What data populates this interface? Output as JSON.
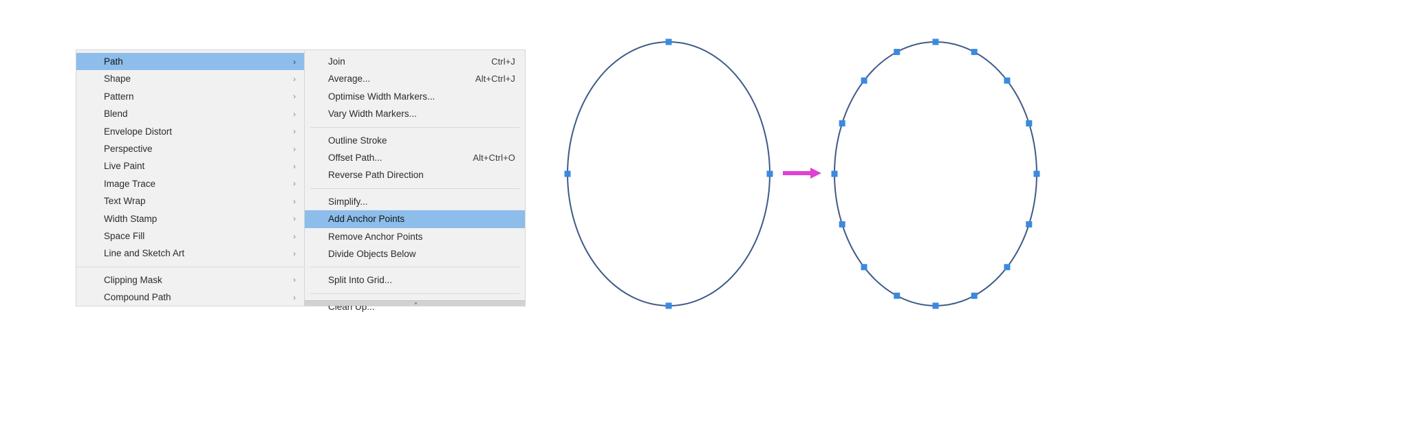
{
  "app": {
    "context": "Adobe Illustrator Object menu cascade showing Path submenu with Add Anchor Points highlighted"
  },
  "menu_level_1": {
    "name": "Object submenu",
    "items": [
      {
        "label": "Path",
        "has_submenu": true,
        "submenu_glyph": "›",
        "highlighted": true,
        "separator_after": false
      },
      {
        "label": "Shape",
        "has_submenu": true,
        "submenu_glyph": "›",
        "highlighted": false,
        "separator_after": false
      },
      {
        "label": "Pattern",
        "has_submenu": true,
        "submenu_glyph": "›",
        "highlighted": false,
        "separator_after": false
      },
      {
        "label": "Blend",
        "has_submenu": true,
        "submenu_glyph": "›",
        "highlighted": false,
        "separator_after": false
      },
      {
        "label": "Envelope Distort",
        "has_submenu": true,
        "submenu_glyph": "›",
        "highlighted": false,
        "separator_after": false
      },
      {
        "label": "Perspective",
        "has_submenu": true,
        "submenu_glyph": "›",
        "highlighted": false,
        "separator_after": false
      },
      {
        "label": "Live Paint",
        "has_submenu": true,
        "submenu_glyph": "›",
        "highlighted": false,
        "separator_after": false
      },
      {
        "label": "Image Trace",
        "has_submenu": true,
        "submenu_glyph": "›",
        "highlighted": false,
        "separator_after": false
      },
      {
        "label": "Text Wrap",
        "has_submenu": true,
        "submenu_glyph": "›",
        "highlighted": false,
        "separator_after": false
      },
      {
        "label": "Width Stamp",
        "has_submenu": true,
        "submenu_glyph": "›",
        "highlighted": false,
        "separator_after": false
      },
      {
        "label": "Space Fill",
        "has_submenu": true,
        "submenu_glyph": "›",
        "highlighted": false,
        "separator_after": false
      },
      {
        "label": "Line and Sketch Art",
        "has_submenu": true,
        "submenu_glyph": "›",
        "highlighted": false,
        "separator_after": true
      },
      {
        "label": "Clipping Mask",
        "has_submenu": true,
        "submenu_glyph": "›",
        "highlighted": false,
        "separator_after": false
      },
      {
        "label": "Compound Path",
        "has_submenu": true,
        "submenu_glyph": "›",
        "highlighted": false,
        "separator_after": false
      }
    ]
  },
  "menu_level_2": {
    "name": "Path submenu",
    "items": [
      {
        "label": "Join",
        "shortcut": "Ctrl+J",
        "highlighted": false,
        "separator_after": false
      },
      {
        "label": "Average...",
        "shortcut": "Alt+Ctrl+J",
        "highlighted": false,
        "separator_after": false
      },
      {
        "label": "Optimise Width Markers...",
        "shortcut": "",
        "highlighted": false,
        "separator_after": false
      },
      {
        "label": "Vary Width Markers...",
        "shortcut": "",
        "highlighted": false,
        "separator_after": true
      },
      {
        "label": "Outline Stroke",
        "shortcut": "",
        "highlighted": false,
        "separator_after": false
      },
      {
        "label": "Offset Path...",
        "shortcut": "Alt+Ctrl+O",
        "highlighted": false,
        "separator_after": false
      },
      {
        "label": "Reverse Path Direction",
        "shortcut": "",
        "highlighted": false,
        "separator_after": true
      },
      {
        "label": "Simplify...",
        "shortcut": "",
        "highlighted": false,
        "separator_after": false
      },
      {
        "label": "Add Anchor Points",
        "shortcut": "",
        "highlighted": true,
        "separator_after": false
      },
      {
        "label": "Remove Anchor Points",
        "shortcut": "",
        "highlighted": false,
        "separator_after": false
      },
      {
        "label": "Divide Objects Below",
        "shortcut": "",
        "highlighted": false,
        "separator_after": true
      },
      {
        "label": "Split Into Grid...",
        "shortcut": "",
        "highlighted": false,
        "separator_after": true
      },
      {
        "label": "Clean Up...",
        "shortcut": "",
        "highlighted": false,
        "separator_after": false
      }
    ]
  },
  "artboard": {
    "name": "Illustration of add-anchor-points result",
    "stroke_color": "#3f5a87",
    "anchor_color": "#3a8ae0",
    "arrow_color": "#e23fd4",
    "before_shape": {
      "name": "ellipse-before",
      "anchor_count": 4,
      "anchor_angles_deg": [
        270,
        0,
        90,
        180
      ]
    },
    "after_shape": {
      "name": "ellipse-after",
      "anchor_count": 16,
      "anchor_angles_deg": [
        270,
        292.5,
        315,
        337.5,
        0,
        22.5,
        45,
        67.5,
        90,
        112.5,
        135,
        157.5,
        180,
        202.5,
        225,
        247.5
      ]
    },
    "arrow": {
      "name": "transform-arrow",
      "direction": "right"
    }
  }
}
